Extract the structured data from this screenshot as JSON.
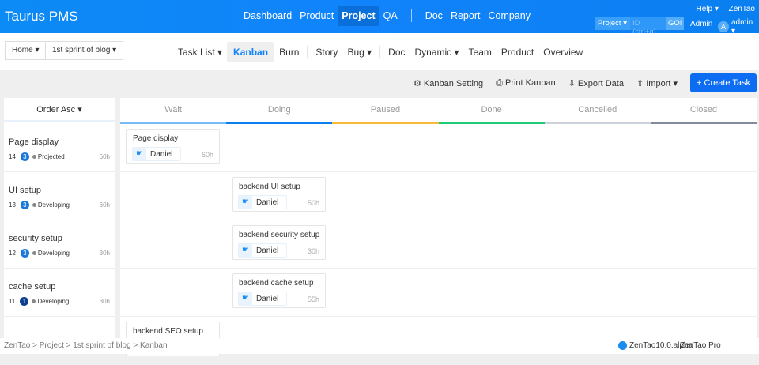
{
  "header": {
    "brand": "Taurus PMS",
    "nav": [
      "Dashboard",
      "Product",
      "Project",
      "QA"
    ],
    "nav2": [
      "Doc",
      "Report",
      "Company"
    ],
    "active": "Project",
    "help": "Help ▾",
    "zentao": "ZenTao",
    "search_scope": "Project ▾",
    "search_placeholder": "ID (ctrl+g)",
    "go": "GO!",
    "admin_link": "Admin",
    "avatar_letter": "A",
    "user": "admin ▾"
  },
  "breadcrumb": {
    "home": "Home ▾",
    "project": "1st sprint of blog ▾"
  },
  "subnav": {
    "items": [
      "Task List ▾",
      "Kanban",
      "Burn",
      "Story",
      "Bug ▾",
      "Doc",
      "Dynamic ▾",
      "Team",
      "Product",
      "Overview"
    ]
  },
  "toolbar": {
    "setting": "Kanban Setting",
    "print": "Print Kanban",
    "export": "Export Data",
    "import": "Import ▾",
    "create": "+ Create Task"
  },
  "left": {
    "order": "Order Asc ▾"
  },
  "columns": [
    {
      "label": "Wait",
      "color": "#78bdfa"
    },
    {
      "label": "Doing",
      "color": "#0a7ff0"
    },
    {
      "label": "Paused",
      "color": "#f7b937"
    },
    {
      "label": "Done",
      "color": "#1ecb75"
    },
    {
      "label": "Cancelled",
      "color": "#cdd1d9"
    },
    {
      "label": "Closed",
      "color": "#838a9b"
    }
  ],
  "stories": [
    {
      "name": "Page display",
      "id": "14",
      "pri": "3",
      "status": "Projected",
      "est": "60h",
      "card": {
        "title": "Page display",
        "user": "Daniel",
        "hours": "60h",
        "col": 0
      }
    },
    {
      "name": "UI setup",
      "id": "13",
      "pri": "3",
      "status": "Developing",
      "est": "60h",
      "card": {
        "title": "backend UI setup",
        "user": "Daniel",
        "hours": "50h",
        "col": 1
      }
    },
    {
      "name": "security setup",
      "id": "12",
      "pri": "3",
      "status": "Developing",
      "est": "30h",
      "card": {
        "title": "backend security setup",
        "user": "Daniel",
        "hours": "30h",
        "col": 1
      }
    },
    {
      "name": "cache setup",
      "id": "11",
      "pri": "1",
      "status": "Developing",
      "est": "30h",
      "card": {
        "title": "backend cache setup",
        "user": "Daniel",
        "hours": "55h",
        "col": 1
      }
    },
    {
      "name": "",
      "id": "",
      "pri": "",
      "status": "",
      "est": "",
      "card": {
        "title": "backend SEO setup",
        "user": "",
        "hours": "",
        "col": 0
      }
    }
  ],
  "footer": {
    "breadcrumb": "ZenTao > Project > 1st sprint of blog > Kanban",
    "version": "ZenTao10.0.alpha",
    "pro": "ZenTao Pro"
  }
}
